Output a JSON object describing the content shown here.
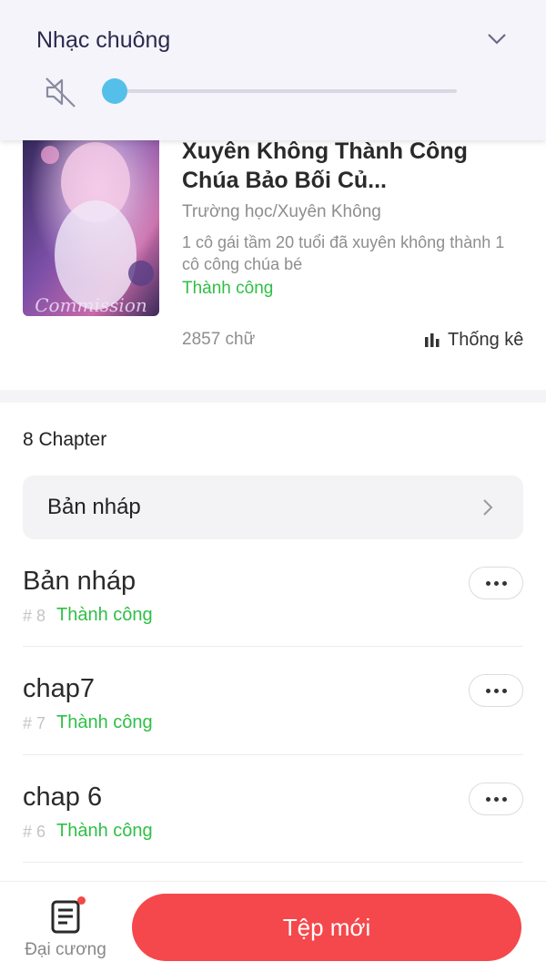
{
  "volume": {
    "title": "Nhạc chuông",
    "level": 0
  },
  "book": {
    "title": "Xuyên Không Thành Công Chúa Bảo Bối Củ...",
    "genre": "Trường học/Xuyên Không",
    "description": "1 cô gái tầm 20 tuổi đã xuyên không thành 1 cô công chúa bé",
    "status": "Thành công",
    "word_count": "2857 chữ",
    "stats_label": "Thống kê",
    "cover_text": "Commission"
  },
  "chapters_header": "8 Chapter",
  "draft_bar_label": "Bản nháp",
  "chapters": [
    {
      "title": "Bản nháp",
      "number": "# 8",
      "status": "Thành công"
    },
    {
      "title": "chap7",
      "number": "# 7",
      "status": "Thành công"
    },
    {
      "title": "chap 6",
      "number": "# 6",
      "status": "Thành công"
    }
  ],
  "bottom": {
    "outline_label": "Đại cương",
    "new_file_label": "Tệp mới"
  },
  "colors": {
    "accent_red": "#f5484c",
    "success_green": "#2fbf46",
    "slider_blue": "#54c0ea"
  }
}
